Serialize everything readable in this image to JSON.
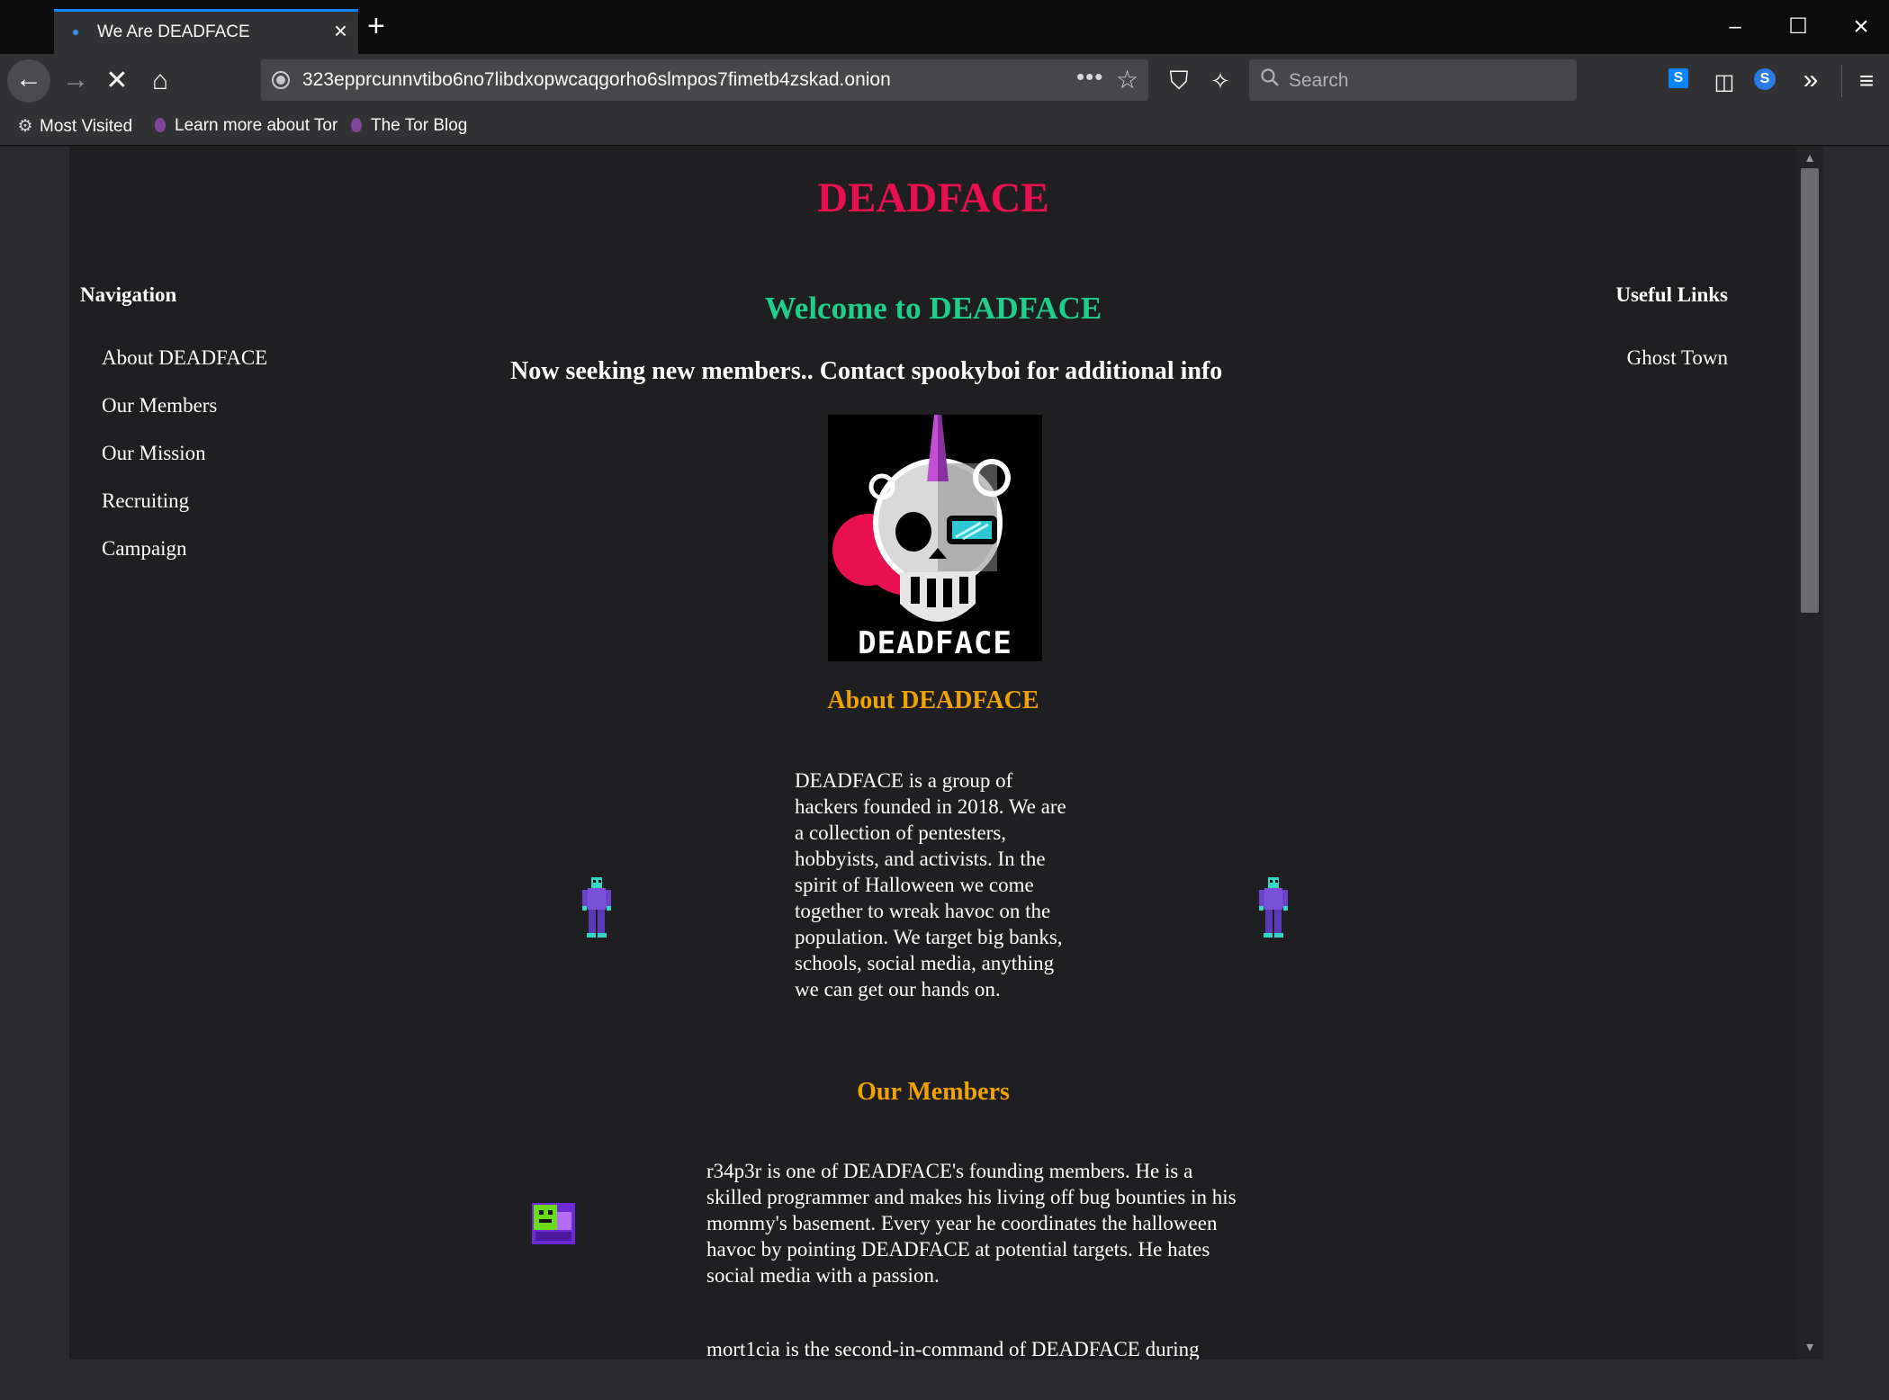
{
  "browser": {
    "tab_title": "We Are DEADFACE",
    "url": "323epprcunnvtibo6no7libdxopwcaqgorho6slmpos7fimetb4zskad.onion",
    "search_placeholder": "Search",
    "bookmarks": [
      "Most Visited",
      "Learn more about Tor",
      "The Tor Blog"
    ],
    "accent_color": "#0a84ff"
  },
  "site": {
    "title": "DEADFACE",
    "title_color": "#e8104e",
    "welcome": "Welcome to DEADFACE",
    "welcome_color": "#1dcf8a",
    "seeking": "Now seeking new members.. Contact spookyboi for additional info",
    "logo_text": "DEADFACE",
    "section_color": "#f0a300"
  },
  "navigation": {
    "heading": "Navigation",
    "items": [
      "About DEADFACE",
      "Our Members",
      "Our Mission",
      "Recruiting",
      "Campaign"
    ]
  },
  "useful_links": {
    "heading": "Useful Links",
    "items": [
      "Ghost Town"
    ]
  },
  "about": {
    "heading": "About DEADFACE",
    "body": "DEADFACE is a group of hackers founded in 2018. We are a collection of pentesters, hobbyists, and activists. In the spirit of Halloween we come together to wreak havoc on the population. We target big banks, schools, social media, anything we can get our hands on."
  },
  "members": {
    "heading": "Our Members",
    "list": [
      "r34p3r is one of DEADFACE's founding members. He is a skilled programmer and makes his living off bug bounties in his mommy's basement. Every year he coordinates the halloween havoc by pointing DEADFACE at potential targets. He hates social media with a passion.",
      "mort1cia is the second-in-command of DEADFACE during"
    ]
  }
}
